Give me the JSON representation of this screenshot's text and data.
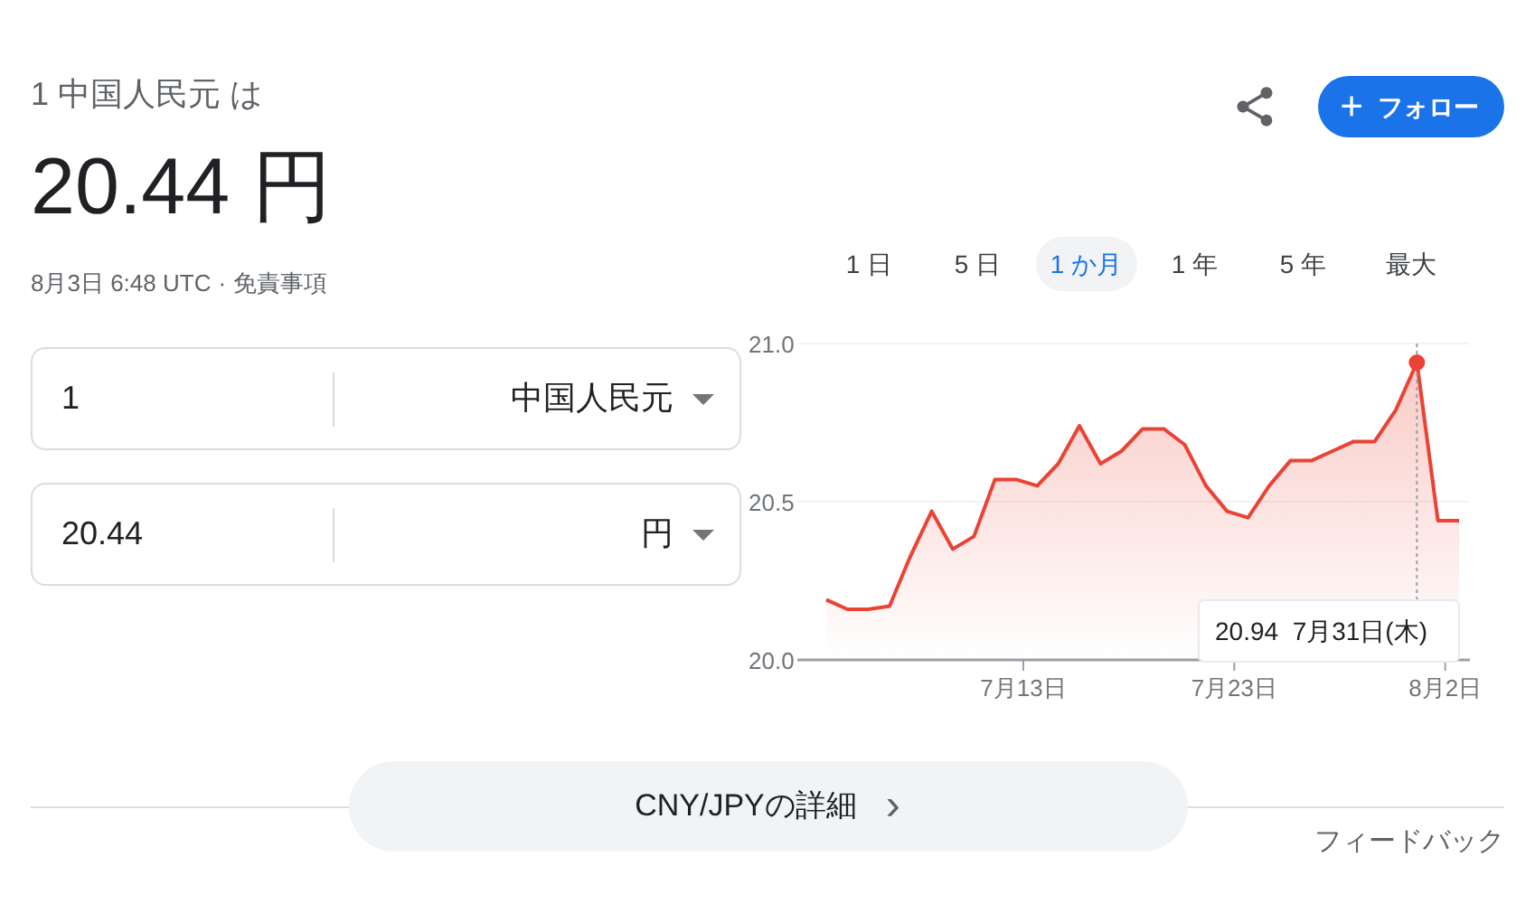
{
  "header": {
    "subtitle": "1 中国人民元 は",
    "rate": "20.44 円",
    "timestamp": "8月3日 6:48 UTC",
    "separator": "·",
    "disclaimer": "免責事項"
  },
  "actions": {
    "follow": {
      "icon": "+",
      "label": "フォロー"
    }
  },
  "ranges": [
    {
      "label": "1 日",
      "selected": false
    },
    {
      "label": "5 日",
      "selected": false
    },
    {
      "label": "1 か月",
      "selected": true
    },
    {
      "label": "1 年",
      "selected": false
    },
    {
      "label": "5 年",
      "selected": false
    },
    {
      "label": "最大",
      "selected": false
    }
  ],
  "converter": [
    {
      "amount": "1",
      "currency": "中国人民元"
    },
    {
      "amount": "20.44",
      "currency": "円"
    }
  ],
  "chart": {
    "chart_data": {
      "type": "area",
      "categories": [
        null,
        null,
        null,
        null,
        null,
        null,
        null,
        null,
        null,
        "7月13日",
        null,
        null,
        null,
        null,
        null,
        null,
        null,
        null,
        null,
        "7月23日",
        null,
        null,
        null,
        null,
        null,
        null,
        null,
        null,
        null,
        "8月2日",
        null
      ],
      "series": [
        {
          "color": "#ea4335",
          "values": [
            20.19,
            20.16,
            20.16,
            20.17,
            20.33,
            20.47,
            20.35,
            20.39,
            20.57,
            20.57,
            20.55,
            20.62,
            20.74,
            20.62,
            20.66,
            20.73,
            20.73,
            20.68,
            20.55,
            20.47,
            20.45,
            20.55,
            20.63,
            20.63,
            20.66,
            20.69,
            20.69,
            20.79,
            20.94,
            20.44,
            20.44
          ]
        }
      ],
      "ylim": [
        20.0,
        21.0
      ],
      "yticks": [
        {
          "value": 20.0,
          "label": "20.0"
        },
        {
          "value": 20.5,
          "label": "20.5"
        },
        {
          "value": 21.0,
          "label": "21.0"
        }
      ],
      "annotations": [
        "20.94  7月31日(木)"
      ]
    }
  },
  "footer": {
    "details": {
      "label": "CNY/JPYの詳細",
      "icon": "›"
    },
    "feedback": "フィードバック"
  }
}
